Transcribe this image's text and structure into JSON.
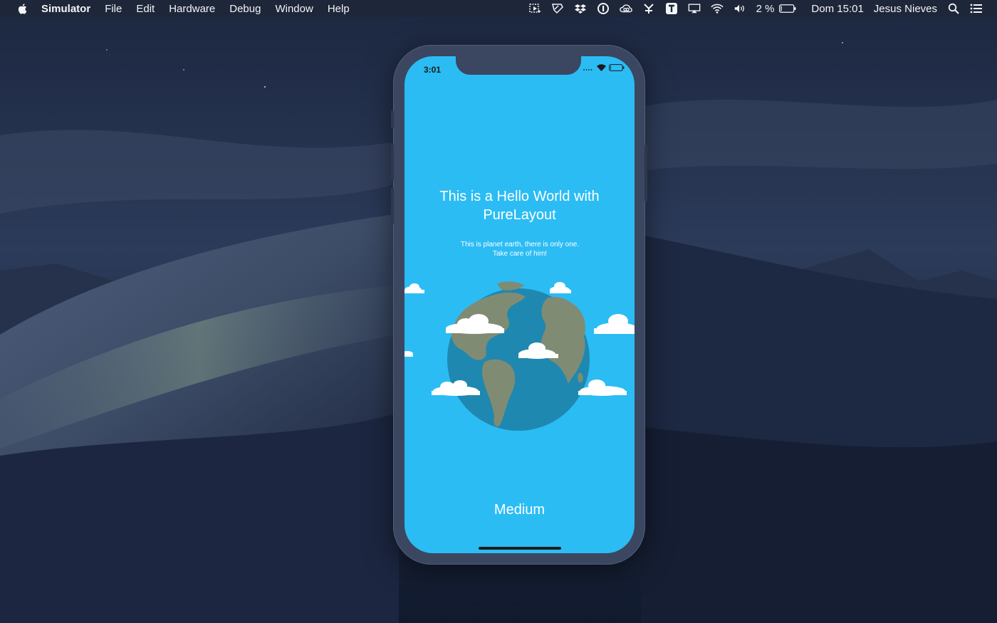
{
  "menubar": {
    "app_name": "Simulator",
    "menus": [
      "File",
      "Edit",
      "Hardware",
      "Debug",
      "Window",
      "Help"
    ],
    "battery_text": "2 %",
    "clock": "Dom 15:01",
    "user": "Jesus Nieves",
    "icons": [
      "screenshot-icon",
      "pen-icon",
      "dropbox-icon",
      "1password-icon",
      "creative-cloud-icon",
      "vpn-icon",
      "typeeto-icon",
      "airplay-icon",
      "wifi-icon",
      "volume-icon",
      "battery-icon",
      "spotlight-icon",
      "notification-center-icon"
    ]
  },
  "simulator": {
    "status_bar": {
      "time": "3:01"
    },
    "title": "This is a Hello World with PureLayout",
    "subtitle": "This is planet earth, there is only one. Take care of him!",
    "bottom_label": "Medium"
  },
  "colors": {
    "screen_bg": "#2bbcf4",
    "ocean": "#1f88b0",
    "land": "#7f8c73",
    "cloud": "#ffffff",
    "phone_frame": "#3b4660"
  }
}
